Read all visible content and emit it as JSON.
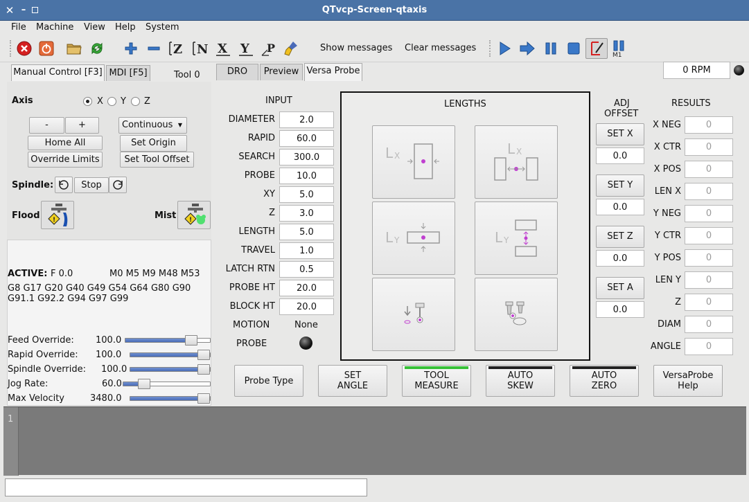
{
  "window": {
    "title": "QTvcp-Screen-qtaxis"
  },
  "menu": [
    "File",
    "Machine",
    "View",
    "Help",
    "System"
  ],
  "toolbar": {
    "show_messages": "Show messages",
    "clear_messages": "Clear messages"
  },
  "left_tabs": {
    "manual": "Manual Control [F3]",
    "mdi": "MDI [F5]",
    "tool": "Tool 0"
  },
  "right_tabs": {
    "dro": "DRO",
    "preview": "Preview",
    "versa": "Versa Probe"
  },
  "rpm": "0 RPM",
  "manual": {
    "axis_label": "Axis",
    "axes": [
      "X",
      "Y",
      "Z"
    ],
    "selected_axis": "X",
    "minus": "-",
    "plus": "+",
    "jog_mode": "Continuous",
    "home_all": "Home All",
    "set_origin": "Set Origin",
    "override_limits": "Override Limits",
    "set_tool_offset": "Set Tool Offset",
    "spindle_label": "Spindle:",
    "stop": "Stop",
    "flood": "Flood",
    "mist": "Mist"
  },
  "status": {
    "active_label": "ACTIVE:",
    "feed": "F 0.0",
    "mcodes": "M0 M5 M9 M48 M53",
    "gcodes_line1": "G8 G17 G20 G40 G49 G54 G64 G80 G90",
    "gcodes_line2": "G91.1 G92.2 G94 G97 G99"
  },
  "overrides": [
    {
      "label": "Feed Override:",
      "value": "100.0",
      "fraction": 0.83
    },
    {
      "label": "Rapid Override:",
      "value": "100.0",
      "fraction": 1.0
    },
    {
      "label": "Spindle Override:",
      "value": "100.0",
      "fraction": 1.0
    },
    {
      "label": "Jog Rate:",
      "value": "60.0",
      "fraction": 0.2
    },
    {
      "label": "Max Velocity",
      "value": "3480.0",
      "fraction": 1.0
    }
  ],
  "input": {
    "header": "INPUT",
    "rows": [
      {
        "label": "DIAMETER",
        "value": "2.0"
      },
      {
        "label": "RAPID",
        "value": "60.0"
      },
      {
        "label": "SEARCH",
        "value": "300.0"
      },
      {
        "label": "PROBE",
        "value": "10.0"
      },
      {
        "label": "XY",
        "value": "5.0"
      },
      {
        "label": "Z",
        "value": "3.0"
      },
      {
        "label": "LENGTH",
        "value": "5.0"
      },
      {
        "label": "TRAVEL",
        "value": "1.0"
      },
      {
        "label": "LATCH RTN",
        "value": "0.5"
      },
      {
        "label": "PROBE HT",
        "value": "20.0"
      },
      {
        "label": "BLOCK HT",
        "value": "20.0"
      }
    ],
    "motion_label": "MOTION",
    "motion_value": "None",
    "probe_label": "PROBE"
  },
  "lengths": {
    "header": "LENGTHS"
  },
  "adj": {
    "header_line1": "ADJ",
    "header_line2": "OFFSET",
    "items": [
      {
        "button": "SET  X",
        "value": "0.0"
      },
      {
        "button": "SET  Y",
        "value": "0.0"
      },
      {
        "button": "SET  Z",
        "value": "0.0"
      },
      {
        "button": "SET  A",
        "value": "0.0"
      }
    ]
  },
  "results": {
    "header": "RESULTS",
    "rows": [
      {
        "label": "X NEG",
        "value": "0"
      },
      {
        "label": "X CTR",
        "value": "0"
      },
      {
        "label": "X POS",
        "value": "0"
      },
      {
        "label": "LEN X",
        "value": "0"
      },
      {
        "label": "Y NEG",
        "value": "0"
      },
      {
        "label": "Y CTR",
        "value": "0"
      },
      {
        "label": "Y POS",
        "value": "0"
      },
      {
        "label": "LEN Y",
        "value": "0"
      },
      {
        "label": "Z",
        "value": "0"
      },
      {
        "label": "DIAM",
        "value": "0"
      },
      {
        "label": "ANGLE",
        "value": "0"
      }
    ]
  },
  "bottom_buttons": [
    {
      "line1": "Probe Type",
      "line2": "",
      "bar": ""
    },
    {
      "line1": "SET",
      "line2": "ANGLE",
      "bar": ""
    },
    {
      "line1": "TOOL",
      "line2": "MEASURE",
      "bar": "#38c038"
    },
    {
      "line1": "AUTO",
      "line2": "SKEW",
      "bar": "#222222"
    },
    {
      "line1": "AUTO",
      "line2": "ZERO",
      "bar": "#222222"
    },
    {
      "line1": "VersaProbe",
      "line2": "Help",
      "bar": ""
    }
  ],
  "gcode": {
    "line_number": "1"
  },
  "colors": {
    "titlebar": "#4a73a6",
    "gcode_bg": "#7a7a7a",
    "highlight_purple": "#c040d0"
  }
}
